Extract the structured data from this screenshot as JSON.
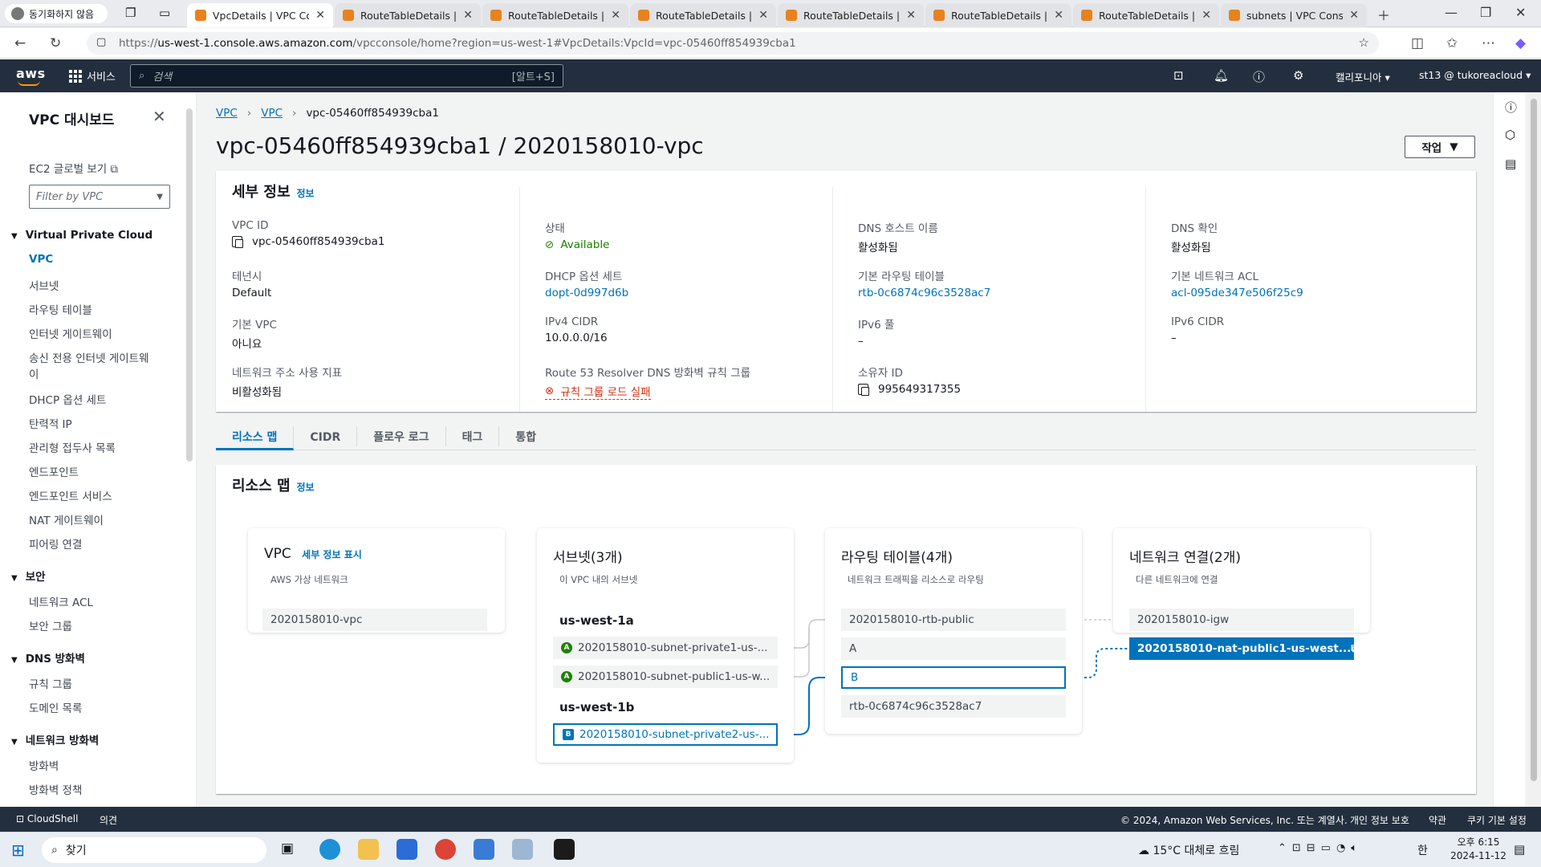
{
  "browser": {
    "profile_label": "동기화하지 않음",
    "tabs": [
      {
        "title": "VpcDetails | VPC Console"
      },
      {
        "title": "RouteTableDetails | VPC"
      },
      {
        "title": "RouteTableDetails | VPC"
      },
      {
        "title": "RouteTableDetails | VPC"
      },
      {
        "title": "RouteTableDetails | VPC"
      },
      {
        "title": "RouteTableDetails | VPC"
      },
      {
        "title": "RouteTableDetails | VPC"
      },
      {
        "title": "subnets | VPC Console"
      }
    ],
    "url_prefix": "https://",
    "url_host": "us-west-1.console.aws.amazon.com",
    "url_path": "/vpcconsole/home?region=us-west-1#VpcDetails:VpcId=vpc-05460ff854939cba1"
  },
  "aws_nav": {
    "logo": "aws",
    "services": "서비스",
    "search_placeholder": "검색",
    "search_shortcut": "[알트+S]",
    "region": "캘리포니아 ▾",
    "account": "st13 @ tukoreacloud ▾"
  },
  "sidebar": {
    "title": "VPC 대시보드",
    "ec2_global": "EC2 글로벌 보기",
    "filter_placeholder": "Filter by VPC",
    "sections": {
      "vpc": "Virtual Private Cloud",
      "security": "보안",
      "dns_firewall": "DNS 방화벽",
      "network_firewall": "네트워크 방화벽"
    },
    "vpc_items": [
      "VPC",
      "서브넷",
      "라우팅 테이블",
      "인터넷 게이트웨이",
      "송신 전용 인터넷 게이트웨",
      "이",
      "DHCP 옵션 세트",
      "탄력적 IP",
      "관리형 접두사 목록",
      "엔드포인트",
      "엔드포인트 서비스",
      "NAT 게이트웨이",
      "피어링 연결"
    ],
    "security_items": [
      "네트워크 ACL",
      "보안 그룹"
    ],
    "dns_items": [
      "규칙 그룹",
      "도메인 목록"
    ],
    "nf_items": [
      "방화벽",
      "방화벽 정책"
    ]
  },
  "breadcrumb": {
    "a": "VPC",
    "b": "VPC",
    "c": "vpc-05460ff854939cba1"
  },
  "page_title": "vpc-05460ff854939cba1 / 2020158010-vpc",
  "actions_label": "작업",
  "details": {
    "heading": "세부 정보",
    "info": "정보",
    "vpc_id_label": "VPC ID",
    "vpc_id": "vpc-05460ff854939cba1",
    "state_label": "상태",
    "state": "Available",
    "dns_host_label": "DNS 호스트 이름",
    "dns_host": "활성화됨",
    "dns_res_label": "DNS 확인",
    "dns_res": "활성화됨",
    "tenancy_label": "테넌시",
    "tenancy": "Default",
    "dhcp_label": "DHCP 옵션 세트",
    "dhcp": "dopt-0d997d6b",
    "main_rt_label": "기본 라우팅 테이블",
    "main_rt": "rtb-0c6874c96c3528ac7",
    "main_acl_label": "기본 네트워크 ACL",
    "main_acl": "acl-095de347e506f25c9",
    "default_vpc_label": "기본 VPC",
    "default_vpc": "아니요",
    "ipv4_label": "IPv4 CIDR",
    "ipv4": "10.0.0.0/16",
    "ipv6pool_label": "IPv6 풀",
    "ipv6pool": "–",
    "ipv6cidr_label": "IPv6 CIDR",
    "ipv6cidr": "–",
    "nau_label": "네트워크 주소 사용 지표",
    "nau": "비활성화됨",
    "r53_label": "Route 53 Resolver DNS 방화벽 규칙 그룹",
    "r53": "규칙 그룹 로드 실패",
    "owner_label": "소유자 ID",
    "owner": "995649317355"
  },
  "tabs": [
    "리소스 맵",
    "CIDR",
    "플로우 로그",
    "태그",
    "통합"
  ],
  "resource_map": {
    "heading": "리소스 맵",
    "info": "정보",
    "vpc": {
      "title": "VPC",
      "show": "세부 정보 표시",
      "sub": "AWS 가상 네트워크",
      "item": "2020158010-vpc"
    },
    "subnets": {
      "title": "서브넷(3개)",
      "sub": "이 VPC 내의 서브넷",
      "az1": "us-west-1a",
      "az2": "us-west-1b",
      "items": [
        "2020158010-subnet-private1-us-...",
        "2020158010-subnet-public1-us-w...",
        "2020158010-subnet-private2-us-..."
      ],
      "badges": [
        "A",
        "A",
        "B"
      ]
    },
    "routes": {
      "title": "라우팅 테이블(4개)",
      "sub": "네트워크 트래픽을 리소스로 라우팅",
      "items": [
        "2020158010-rtb-public",
        "A",
        "B",
        "rtb-0c6874c96c3528ac7"
      ]
    },
    "network": {
      "title": "네트워크 연결(2개)",
      "sub": "다른 네트워크에 연결",
      "items": [
        "2020158010-igw",
        "2020158010-nat-public1-us-west..."
      ]
    }
  },
  "footer": {
    "cloudshell": "CloudShell",
    "feedback": "의견",
    "copyright": "© 2024, Amazon Web Services, Inc. 또는 계열사.",
    "privacy": "개인 정보 보호",
    "terms": "약관",
    "cookies": "쿠키 기본 설정"
  },
  "taskbar": {
    "search": "찾기",
    "weather": "15°C  대체로 흐림",
    "time": "오후 6:15",
    "date": "2024-11-12"
  },
  "colors": {
    "accent": "#0073bb",
    "aws_nav": "#232f3e",
    "success": "#1d8102",
    "error": "#d13212",
    "orange": "#ff9900"
  }
}
